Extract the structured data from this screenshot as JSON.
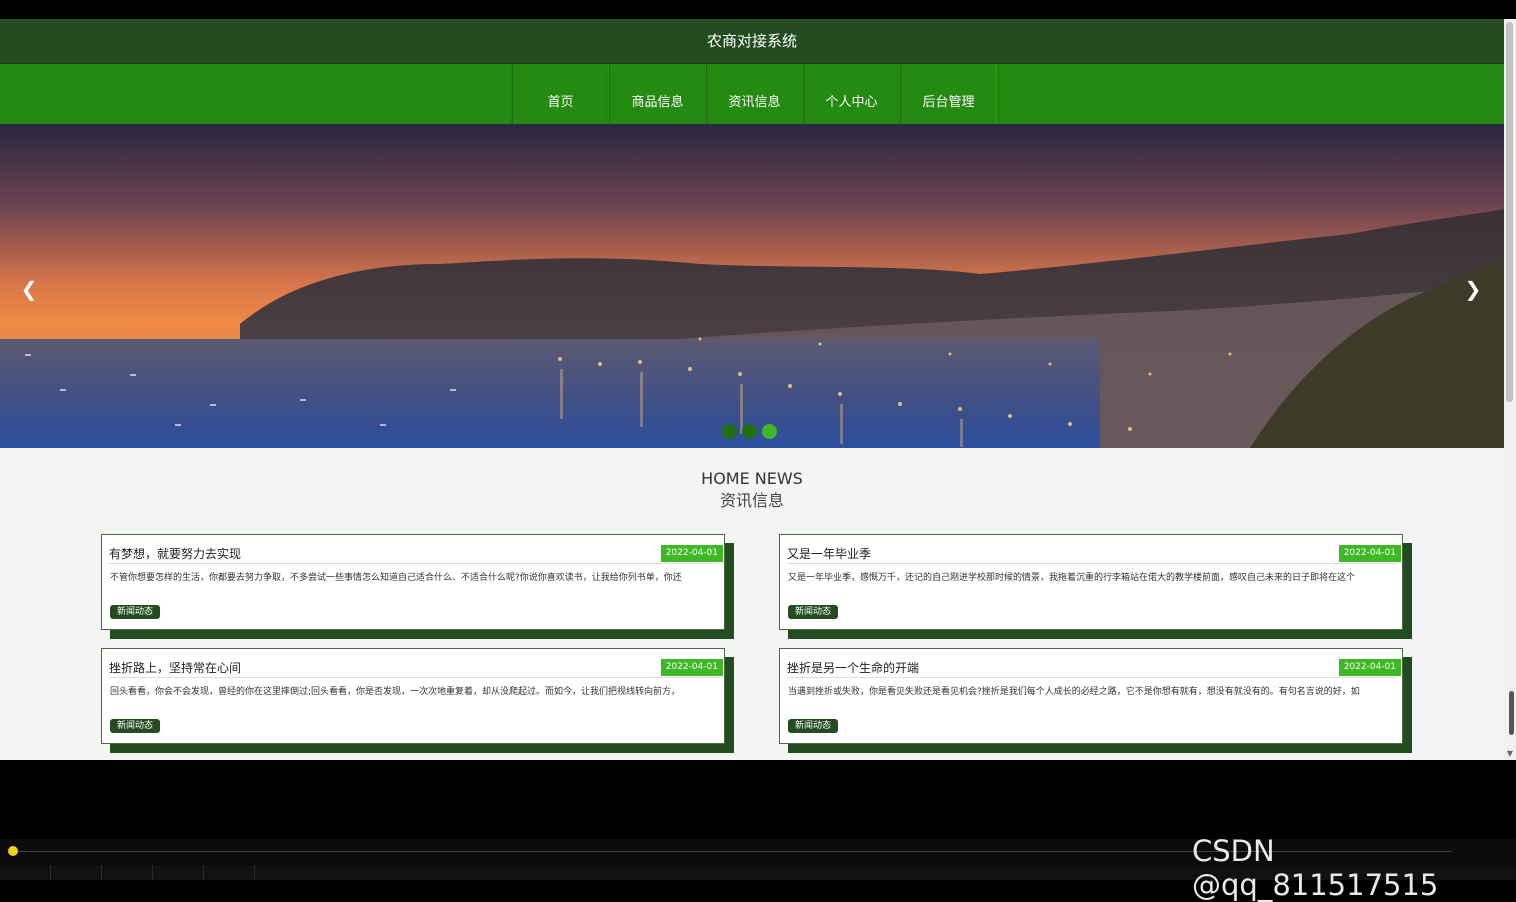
{
  "header": {
    "title": "农商对接系统"
  },
  "nav": {
    "items": [
      "首页",
      "商品信息",
      "资讯信息",
      "个人中心",
      "后台管理"
    ]
  },
  "banner": {
    "prev_icon": "chevron-left-icon",
    "next_icon": "chevron-right-icon",
    "slide_count": 3,
    "active_slide": 3
  },
  "news": {
    "title_en": "HOME NEWS",
    "title_cn": "资讯信息",
    "items": [
      {
        "title": "有梦想，就要努力去实现",
        "date": "2022-04-01",
        "desc": "不管你想要怎样的生活，你都要去努力争取，不多尝试一些事情怎么知道自己适合什么、不适合什么呢?你说你喜欢读书，让我给你列书单，你还",
        "tag": "新闻动态"
      },
      {
        "title": "又是一年毕业季",
        "date": "2022-04-01",
        "desc": "又是一年毕业季，感慨万千，还记的自己刚进学校那时候的情景，我拖着沉重的行李箱站在偌大的教学楼前面，感叹自己未来的日子即将在这个",
        "tag": "新闻动态"
      },
      {
        "title": "挫折路上，坚持常在心间",
        "date": "2022-04-01",
        "desc": "回头看看，你会不会发现，曾经的你在这里摔倒过;回头看看，你是否发现，一次次地重复着，却从没爬起过。而如今，让我们把视线转向前方，",
        "tag": "新闻动态"
      },
      {
        "title": "挫折是另一个生命的开端",
        "date": "2022-04-01",
        "desc": "当遇到挫折或失败，你是看见失败还是看见机会?挫折是我们每个人成长的必经之路，它不是你想有就有，想没有就没有的。有句名言说的好，如",
        "tag": "新闻动态"
      }
    ]
  },
  "player": {
    "watermark": "CSDN @qq_811517515",
    "progress": 0
  }
}
